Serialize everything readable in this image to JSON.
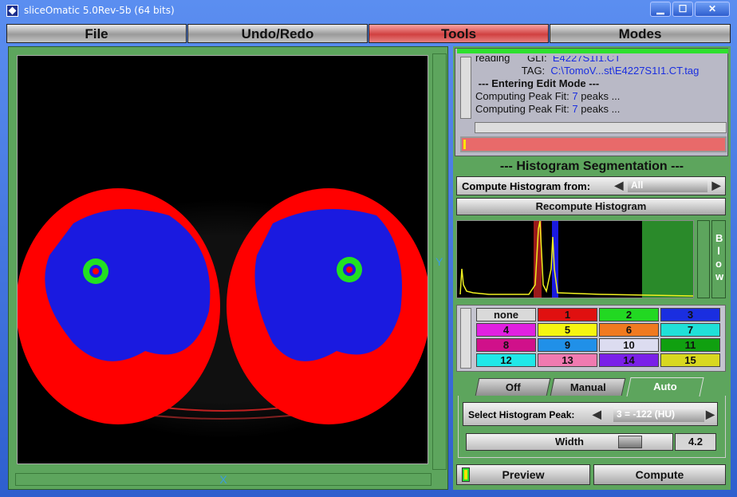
{
  "window": {
    "title": "sliceOmatic 5.0Rev-5b (64 bits)",
    "min_glyph": "▁",
    "max_glyph": "☐",
    "close_glyph": "✕"
  },
  "menu": [
    {
      "label": "File",
      "active": false
    },
    {
      "label": "Undo/Redo",
      "active": false
    },
    {
      "label": "Tools",
      "active": true
    },
    {
      "label": "Modes",
      "active": false
    }
  ],
  "viewer": {
    "y_axis": "Y",
    "x_axis": "X"
  },
  "messages": {
    "line1_label": "reading",
    "line1_key": "GLI:",
    "line1_value": "E4227S1I1.CT",
    "line2_key": "TAG:",
    "line2_value": "C:\\TomoV...st\\E4227S1I1.CT.tag",
    "line3": "--- Entering Edit Mode ---",
    "line4_prefix": "Computing Peak Fit:",
    "line4_count": "7",
    "line4_suffix": "peaks ...",
    "line5_prefix": "Computing Peak Fit:",
    "line5_count": "7",
    "line5_suffix": "peaks ..."
  },
  "seg": {
    "title": "--- Histogram Segmentation ---",
    "compute_from_label": "Compute Histogram from:",
    "compute_from_value": "All",
    "recompute_label": "Recompute Histogram",
    "blow_label": "Blow"
  },
  "palette": [
    {
      "label": "none",
      "color": "#d9d9d9"
    },
    {
      "label": "1",
      "color": "#e01010"
    },
    {
      "label": "2",
      "color": "#22d822"
    },
    {
      "label": "3",
      "color": "#1a2ee0"
    },
    {
      "label": "4",
      "color": "#e020e0"
    },
    {
      "label": "5",
      "color": "#f5f510"
    },
    {
      "label": "6",
      "color": "#f07a20"
    },
    {
      "label": "7",
      "color": "#20e0d8"
    },
    {
      "label": "8",
      "color": "#d0108a"
    },
    {
      "label": "9",
      "color": "#2090e8"
    },
    {
      "label": "10",
      "color": "#dcdcf0"
    },
    {
      "label": "11",
      "color": "#10a010"
    },
    {
      "label": "12",
      "color": "#20e8e8"
    },
    {
      "label": "13",
      "color": "#f07ab0"
    },
    {
      "label": "14",
      "color": "#7a20e8"
    },
    {
      "label": "15",
      "color": "#d8d820"
    }
  ],
  "tabs": [
    {
      "label": "Off",
      "active": false
    },
    {
      "label": "Manual",
      "active": false
    },
    {
      "label": "Auto",
      "active": true
    }
  ],
  "auto": {
    "peak_label": "Select Histogram Peak:",
    "peak_value": "3 = -122 (HU)",
    "width_label": "Width",
    "width_value": "4.2"
  },
  "actions": {
    "preview_label": "Preview",
    "compute_label": "Compute"
  },
  "colors": {
    "tissue_fat": "#ff0000",
    "tissue_muscle": "#1a1ae0",
    "tissue_bone": "#22e022",
    "panel_green": "#5da55d"
  }
}
